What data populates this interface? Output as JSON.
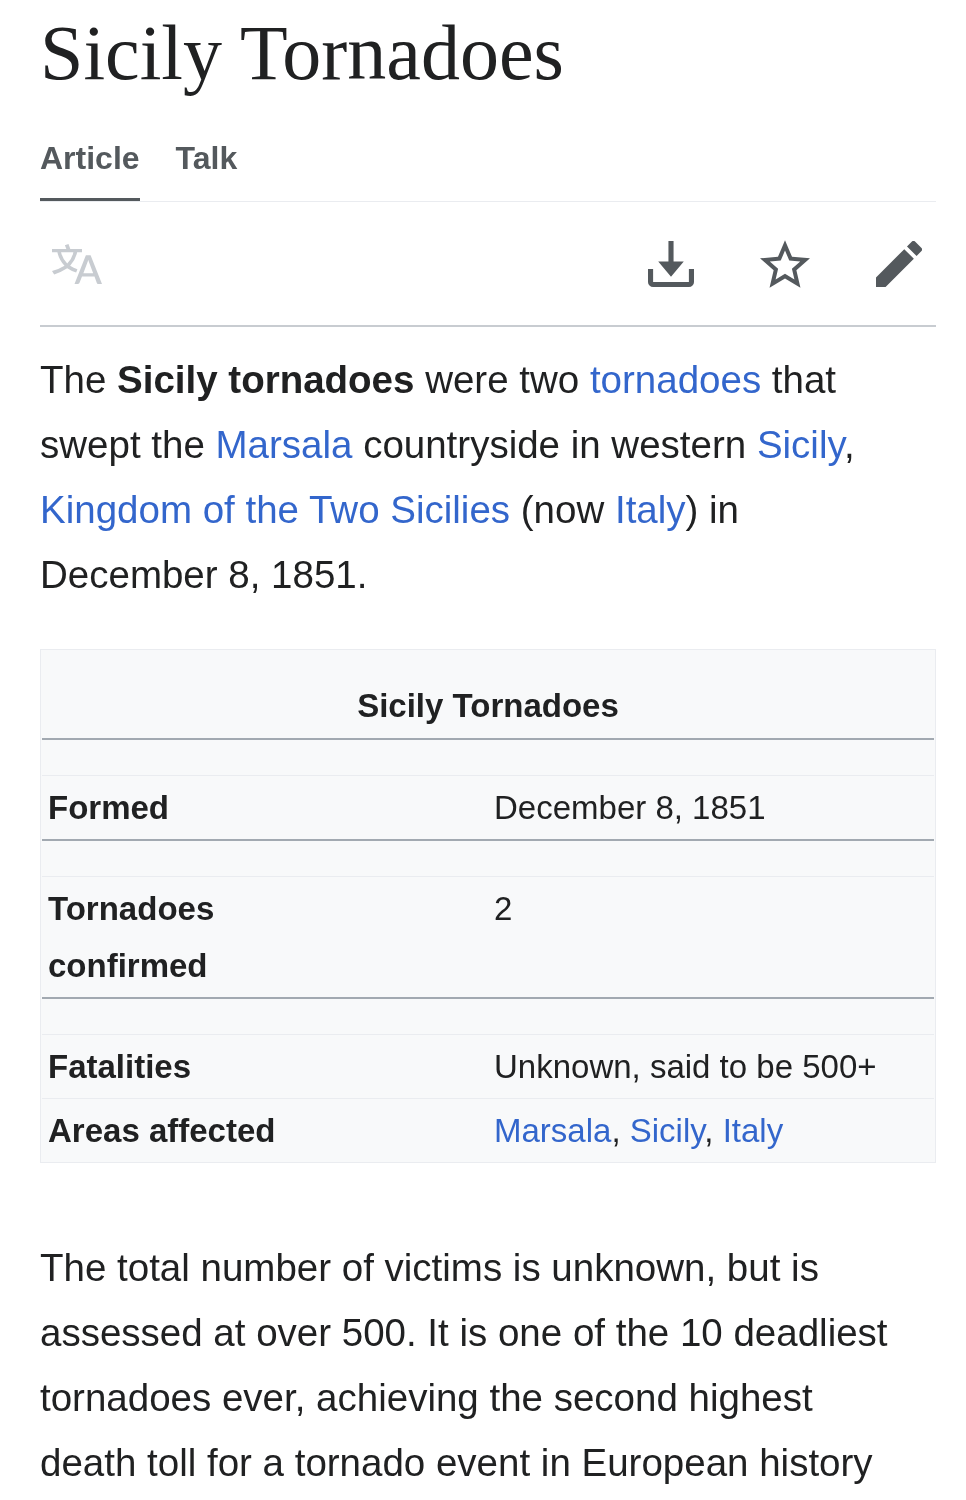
{
  "page": {
    "title": "Sicily Tornadoes"
  },
  "tabs": [
    {
      "label": "Article",
      "selected": true
    },
    {
      "label": "Talk",
      "selected": false
    }
  ],
  "toolbar": [
    {
      "kind": "translate",
      "disabled": true
    },
    {
      "kind": "download",
      "disabled": false
    },
    {
      "kind": "star",
      "disabled": false
    },
    {
      "kind": "edit",
      "disabled": false
    }
  ],
  "intro": [
    {
      "kind": "text",
      "text": "The **Sicily tornadoes** were two "
    },
    {
      "kind": "link",
      "text": "tornadoes"
    },
    {
      "kind": "text",
      "text": " that swept the "
    },
    {
      "kind": "link",
      "text": "Marsala"
    },
    {
      "kind": "text",
      "text": " countryside in western "
    },
    {
      "kind": "link",
      "text": "Sicily"
    },
    {
      "kind": "text",
      "text": ", "
    },
    {
      "kind": "link",
      "text": "Kingdom of the Two Sicilies"
    },
    {
      "kind": "text",
      "text": " (now "
    },
    {
      "kind": "link",
      "text": "Italy"
    },
    {
      "kind": "text",
      "text": ") in December 8, 1851."
    }
  ],
  "infobox": {
    "title": "Sicily Tornadoes",
    "sections": [
      {
        "rows": [
          {
            "label": "Formed",
            "value": [
              {
                "kind": "text",
                "text": "December 8, 1851"
              }
            ]
          }
        ]
      },
      {
        "rows": [
          {
            "label": "Tornadoes confirmed",
            "value": [
              {
                "kind": "text",
                "text": "2"
              }
            ]
          }
        ]
      },
      {
        "rows": [
          {
            "label": "Fatalities",
            "value": [
              {
                "kind": "text",
                "text": "Unknown, said to be 500+"
              }
            ]
          },
          {
            "label": "Areas affected",
            "value": [
              {
                "kind": "link",
                "text": "Marsala",
                "after": ", "
              },
              {
                "kind": "link",
                "text": "Sicily",
                "after": ", "
              },
              {
                "kind": "link",
                "text": "Italy"
              }
            ]
          }
        ]
      }
    ]
  },
  "body_paragraph": "The total number of victims is unknown, but is assessed at over 500. It is one of the 10 deadliest tornadoes ever, achieving the second highest death toll for a tornado event in European history"
}
